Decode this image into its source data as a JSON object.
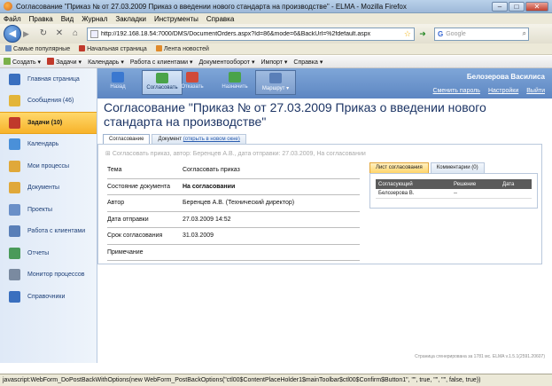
{
  "window": {
    "title": "Согласование \"Приказ № от 27.03.2009 Приказ о введении нового стандарта на производстве\" - ELMA - Mozilla Firefox",
    "controls": {
      "minimize": "–",
      "maximize": "□",
      "close": "✕"
    }
  },
  "menu": [
    "Файл",
    "Правка",
    "Вид",
    "Журнал",
    "Закладки",
    "Инструменты",
    "Справка"
  ],
  "nav": {
    "url": "http://192.168.18.54:7000/DMS/DocumentOrders.aspx?Id=86&mode=6&BackUrl=%2fdefault.aspx",
    "search_placeholder": "Google"
  },
  "bookmarks": [
    "Самые популярные",
    "Начальная страница",
    "Лента новостей"
  ],
  "app_menu": [
    "Создать",
    "Задачи",
    "Календарь",
    "Работа с клиентами",
    "Документооборот",
    "Импорт",
    "Справка"
  ],
  "sidebar": {
    "items": [
      {
        "label": "Главная страница",
        "icon": "home-icon",
        "color": "#3a6fbf",
        "active": false
      },
      {
        "label": "Сообщения (46)",
        "icon": "envelope-icon",
        "color": "#e3b53a",
        "active": false
      },
      {
        "label": "Задачи (10)",
        "icon": "tasks-icon",
        "color": "#c0392b",
        "active": true
      },
      {
        "label": "Календарь",
        "icon": "calendar-icon",
        "color": "#4a90d9",
        "active": false
      },
      {
        "label": "Мои процессы",
        "icon": "folder-icon",
        "color": "#e0a83a",
        "active": false
      },
      {
        "label": "Документы",
        "icon": "folder-documents-icon",
        "color": "#e0a83a",
        "active": false
      },
      {
        "label": "Проекты",
        "icon": "projects-icon",
        "color": "#6a8fc8",
        "active": false
      },
      {
        "label": "Работа с клиентами",
        "icon": "clients-icon",
        "color": "#5a7fb8",
        "active": false
      },
      {
        "label": "Отчеты",
        "icon": "reports-icon",
        "color": "#4a9a5a",
        "active": false
      },
      {
        "label": "Монитор процессов",
        "icon": "monitor-icon",
        "color": "#7a8aa0",
        "active": false
      },
      {
        "label": "Справочники",
        "icon": "handbook-icon",
        "color": "#3a6fbf",
        "active": false
      }
    ]
  },
  "toolbar": {
    "buttons": [
      {
        "label": "Назад",
        "icon": "back-arrow-icon",
        "color": "#3a78d0"
      },
      {
        "label": "Согласовать",
        "icon": "approve-icon",
        "color": "#4aa34a"
      },
      {
        "label": "Отказать",
        "icon": "reject-icon",
        "color": "#d04a3a"
      },
      {
        "label": "Назначить",
        "icon": "assign-icon",
        "color": "#4aa34a"
      },
      {
        "label": "Маршрут",
        "icon": "route-icon",
        "color": "#5a7fb8"
      }
    ]
  },
  "user": {
    "name": "Белозерова Василиса",
    "links": [
      "Сменить пароль",
      "Настройки",
      "Выйти"
    ]
  },
  "document": {
    "title": "Согласование \"Приказ № от 27.03.2009 Приказ о введении нового стандарта на производстве\"",
    "tabs": {
      "approval": "Согласование",
      "document": "Документ",
      "open_new": "(открыть в новом окне)"
    },
    "meta": "Согласовать приказ, автор: Беренцев А.В., дата отправки: 27.03.2009, На согласовании",
    "fields": [
      {
        "label": "Тема",
        "value": "Согласовать приказ",
        "bold": false
      },
      {
        "label": "Состояние документа",
        "value": "На согласовании",
        "bold": true
      },
      {
        "label": "Автор",
        "value": "Беренцев А.В. (Технический директор)",
        "bold": false
      },
      {
        "label": "Дата отправки",
        "value": "27.03.2009 14:52",
        "bold": false
      },
      {
        "label": "Срок согласования",
        "value": "31.03.2009",
        "bold": false
      },
      {
        "label": "Примечание",
        "value": "",
        "bold": false
      }
    ]
  },
  "approval_panel": {
    "tabs": [
      "Лист согласования",
      "Комментарии (0)"
    ],
    "headers": [
      "Согласующий",
      "Решение",
      "Дата"
    ],
    "rows": [
      [
        "Белозерова В.",
        "--",
        ""
      ]
    ]
  },
  "footer_note": "Страница сгенерирована за 1781 мс. ELMA v.1.5.1(2591.20607)",
  "status_bar": "javascript:WebForm_DoPostBackWithOptions(new WebForm_PostBackOptions(\"ctl00$ContentPlaceHolder1$mainToolbar$ctl00$Confirm$Button1\", \"\", true, \"\", \"\", false, true))"
}
